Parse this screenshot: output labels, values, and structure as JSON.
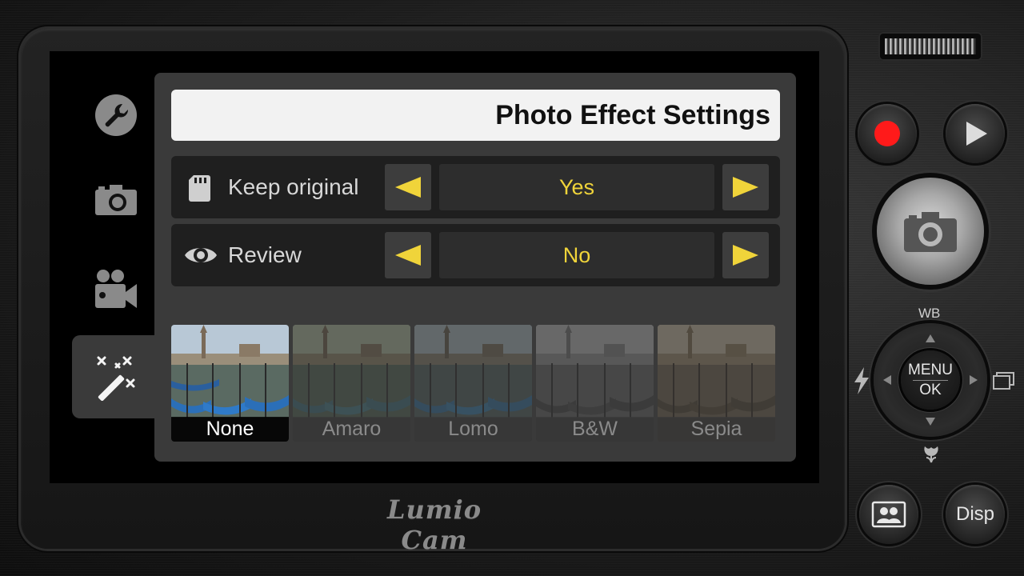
{
  "panel": {
    "title": "Photo Effect Settings",
    "rows": [
      {
        "icon": "sd-card-icon",
        "label": "Keep original",
        "value": "Yes"
      },
      {
        "icon": "eye-icon",
        "label": "Review",
        "value": "No"
      }
    ]
  },
  "effects": [
    {
      "label": "None",
      "selected": true
    },
    {
      "label": "Amaro",
      "selected": false
    },
    {
      "label": "Lomo",
      "selected": false
    },
    {
      "label": "B&W",
      "selected": false
    },
    {
      "label": "Sepia",
      "selected": false
    }
  ],
  "tabs": [
    "wrench-icon",
    "camera-icon",
    "video-camera-icon",
    "magic-wand-icon"
  ],
  "active_tab": "magic-wand-icon",
  "brand": "Lumio Cam",
  "controls": {
    "wb_label": "WB",
    "menu_label": "MENU",
    "ok_label": "OK",
    "disp_label": "Disp"
  },
  "colors": {
    "accent": "#f0d43a",
    "record": "#ff1a1a",
    "panel": "#3a3a3a"
  }
}
